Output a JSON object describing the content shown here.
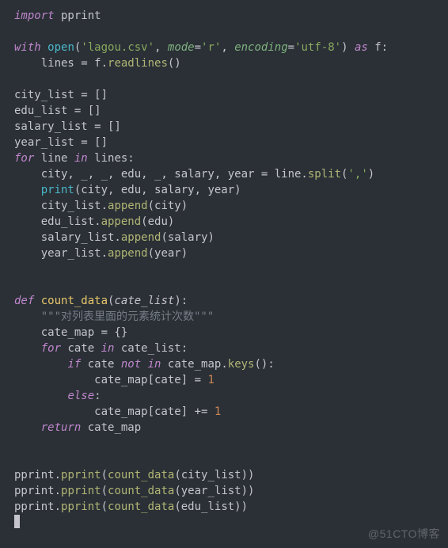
{
  "watermark": "@51CTO博客",
  "code": {
    "l1_import": "import",
    "l1_pprint": " pprint",
    "l3_with": "with",
    "l3_open": "open",
    "l3_lp1": "(",
    "l3_str1": "'lagou.csv'",
    "l3_c1": ", ",
    "l3_mode": "mode",
    "l3_eq1": "=",
    "l3_str2": "'r'",
    "l3_c2": ", ",
    "l3_enc": "encoding",
    "l3_eq2": "=",
    "l3_str3": "'utf-8'",
    "l3_rp1": ") ",
    "l3_as": "as",
    "l3_f": " f:",
    "l4_id": "    lines = f.",
    "l4_read": "readlines",
    "l4_p": "()",
    "l6": "city_list = []",
    "l7": "edu_list = []",
    "l8": "salary_list = []",
    "l9": "year_list = []",
    "l10_for": "for",
    "l10_mid": " line ",
    "l10_in": "in",
    "l10_end": " lines:",
    "l11_a": "    city, _, _, edu, _, salary, year = line.",
    "l11_split": "split",
    "l11_b": "(",
    "l11_str": "','",
    "l11_c": ")",
    "l12_a": "    ",
    "l12_print": "print",
    "l12_b": "(city, edu, salary, year)",
    "l13_a": "    city_list.",
    "l13_app": "append",
    "l13_b": "(city)",
    "l14_a": "    edu_list.",
    "l14_app": "append",
    "l14_b": "(edu)",
    "l15_a": "    salary_list.",
    "l15_app": "append",
    "l15_b": "(salary)",
    "l16_a": "    year_list.",
    "l16_app": "append",
    "l16_b": "(year)",
    "l19_def": "def",
    "l19_sp": " ",
    "l19_name": "count_data",
    "l19_lp": "(",
    "l19_param": "cate_list",
    "l19_rp": "):",
    "l20_a": "    ",
    "l20_doc": "\"\"\"对列表里面的元素统计次数\"\"\"",
    "l21": "    cate_map = {}",
    "l22_a": "    ",
    "l22_for": "for",
    "l22_b": " cate ",
    "l22_in": "in",
    "l22_c": " cate_list:",
    "l23_a": "        ",
    "l23_if": "if",
    "l23_b": " cate ",
    "l23_not": "not",
    "l23_sp": " ",
    "l23_in": "in",
    "l23_c": " cate_map.",
    "l23_keys": "keys",
    "l23_d": "():",
    "l24_a": "            cate_map[cate] = ",
    "l24_num": "1",
    "l25_a": "        ",
    "l25_else": "else",
    "l25_b": ":",
    "l26_a": "            cate_map[cate] += ",
    "l26_num": "1",
    "l27_a": "    ",
    "l27_ret": "return",
    "l27_b": " cate_map",
    "l30_a": "pprint.",
    "l30_pp": "pprint",
    "l30_b": "(",
    "l30_cd": "count_data",
    "l30_c": "(city_list))",
    "l31_a": "pprint.",
    "l31_pp": "pprint",
    "l31_b": "(",
    "l31_cd": "count_data",
    "l31_c": "(year_list))",
    "l32_a": "pprint.",
    "l32_pp": "pprint",
    "l32_b": "(",
    "l32_cd": "count_data",
    "l32_c": "(edu_list))"
  }
}
